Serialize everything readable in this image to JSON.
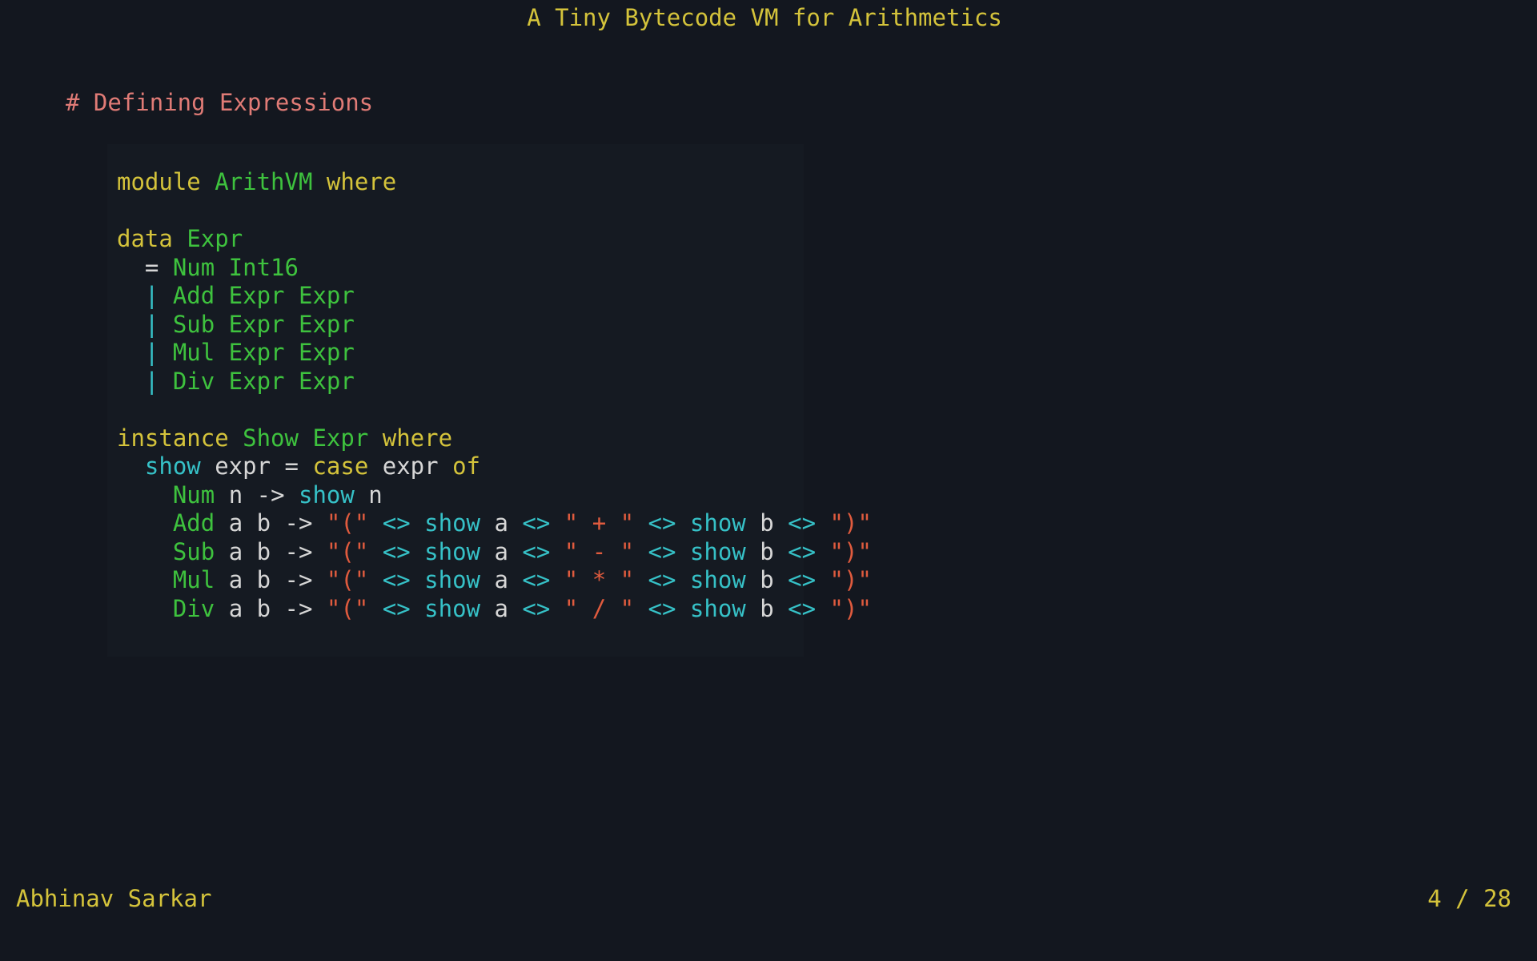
{
  "slide": {
    "title": "A Tiny Bytecode VM for Arithmetics",
    "heading": "# Defining Expressions",
    "author": "Abhinav Sarkar",
    "page": "4 / 28"
  },
  "colors": {
    "background": "#13171f",
    "code_background": "#151a22",
    "keyword": "#d4c33b",
    "type": "#3ec23e",
    "function": "#36c1c7",
    "operator": "#36c1c7",
    "string": "#e05b3e",
    "plain": "#d6d6d6",
    "heading": "#e07b76"
  },
  "code": [
    [
      {
        "t": "module ",
        "k": "keyword"
      },
      {
        "t": "ArithVM",
        "k": "type"
      },
      {
        "t": " where",
        "k": "keyword"
      }
    ],
    [],
    [
      {
        "t": "data ",
        "k": "keyword"
      },
      {
        "t": "Expr",
        "k": "type"
      }
    ],
    [
      {
        "t": "  = ",
        "k": "plain"
      },
      {
        "t": "Num Int16",
        "k": "type"
      }
    ],
    [
      {
        "t": "  | ",
        "k": "operator"
      },
      {
        "t": "Add Expr Expr",
        "k": "type"
      }
    ],
    [
      {
        "t": "  | ",
        "k": "operator"
      },
      {
        "t": "Sub Expr Expr",
        "k": "type"
      }
    ],
    [
      {
        "t": "  | ",
        "k": "operator"
      },
      {
        "t": "Mul Expr Expr",
        "k": "type"
      }
    ],
    [
      {
        "t": "  | ",
        "k": "operator"
      },
      {
        "t": "Div Expr Expr",
        "k": "type"
      }
    ],
    [],
    [
      {
        "t": "instance ",
        "k": "keyword"
      },
      {
        "t": "Show Expr",
        "k": "type"
      },
      {
        "t": " where",
        "k": "keyword"
      }
    ],
    [
      {
        "t": "  ",
        "k": "plain"
      },
      {
        "t": "show",
        "k": "function"
      },
      {
        "t": " expr = ",
        "k": "plain"
      },
      {
        "t": "case",
        "k": "keyword"
      },
      {
        "t": " expr ",
        "k": "plain"
      },
      {
        "t": "of",
        "k": "keyword"
      }
    ],
    [
      {
        "t": "    ",
        "k": "plain"
      },
      {
        "t": "Num",
        "k": "type"
      },
      {
        "t": " n -> ",
        "k": "plain"
      },
      {
        "t": "show",
        "k": "function"
      },
      {
        "t": " n",
        "k": "plain"
      }
    ],
    [
      {
        "t": "    ",
        "k": "plain"
      },
      {
        "t": "Add",
        "k": "type"
      },
      {
        "t": " a b -> ",
        "k": "plain"
      },
      {
        "t": "\"(\"",
        "k": "string"
      },
      {
        "t": " <> ",
        "k": "operator"
      },
      {
        "t": "show",
        "k": "function"
      },
      {
        "t": " a ",
        "k": "plain"
      },
      {
        "t": "<>",
        "k": "operator"
      },
      {
        "t": " \" + \" ",
        "k": "string"
      },
      {
        "t": "<> ",
        "k": "operator"
      },
      {
        "t": "show",
        "k": "function"
      },
      {
        "t": " b ",
        "k": "plain"
      },
      {
        "t": "<> ",
        "k": "operator"
      },
      {
        "t": "\")\"",
        "k": "string"
      }
    ],
    [
      {
        "t": "    ",
        "k": "plain"
      },
      {
        "t": "Sub",
        "k": "type"
      },
      {
        "t": " a b -> ",
        "k": "plain"
      },
      {
        "t": "\"(\"",
        "k": "string"
      },
      {
        "t": " <> ",
        "k": "operator"
      },
      {
        "t": "show",
        "k": "function"
      },
      {
        "t": " a ",
        "k": "plain"
      },
      {
        "t": "<>",
        "k": "operator"
      },
      {
        "t": " \" - \" ",
        "k": "string"
      },
      {
        "t": "<> ",
        "k": "operator"
      },
      {
        "t": "show",
        "k": "function"
      },
      {
        "t": " b ",
        "k": "plain"
      },
      {
        "t": "<> ",
        "k": "operator"
      },
      {
        "t": "\")\"",
        "k": "string"
      }
    ],
    [
      {
        "t": "    ",
        "k": "plain"
      },
      {
        "t": "Mul",
        "k": "type"
      },
      {
        "t": " a b -> ",
        "k": "plain"
      },
      {
        "t": "\"(\"",
        "k": "string"
      },
      {
        "t": " <> ",
        "k": "operator"
      },
      {
        "t": "show",
        "k": "function"
      },
      {
        "t": " a ",
        "k": "plain"
      },
      {
        "t": "<>",
        "k": "operator"
      },
      {
        "t": " \" * \" ",
        "k": "string"
      },
      {
        "t": "<> ",
        "k": "operator"
      },
      {
        "t": "show",
        "k": "function"
      },
      {
        "t": " b ",
        "k": "plain"
      },
      {
        "t": "<> ",
        "k": "operator"
      },
      {
        "t": "\")\"",
        "k": "string"
      }
    ],
    [
      {
        "t": "    ",
        "k": "plain"
      },
      {
        "t": "Div",
        "k": "type"
      },
      {
        "t": " a b -> ",
        "k": "plain"
      },
      {
        "t": "\"(\"",
        "k": "string"
      },
      {
        "t": " <> ",
        "k": "operator"
      },
      {
        "t": "show",
        "k": "function"
      },
      {
        "t": " a ",
        "k": "plain"
      },
      {
        "t": "<>",
        "k": "operator"
      },
      {
        "t": " \" / \" ",
        "k": "string"
      },
      {
        "t": "<> ",
        "k": "operator"
      },
      {
        "t": "show",
        "k": "function"
      },
      {
        "t": " b ",
        "k": "plain"
      },
      {
        "t": "<> ",
        "k": "operator"
      },
      {
        "t": "\")\"",
        "k": "string"
      }
    ]
  ]
}
